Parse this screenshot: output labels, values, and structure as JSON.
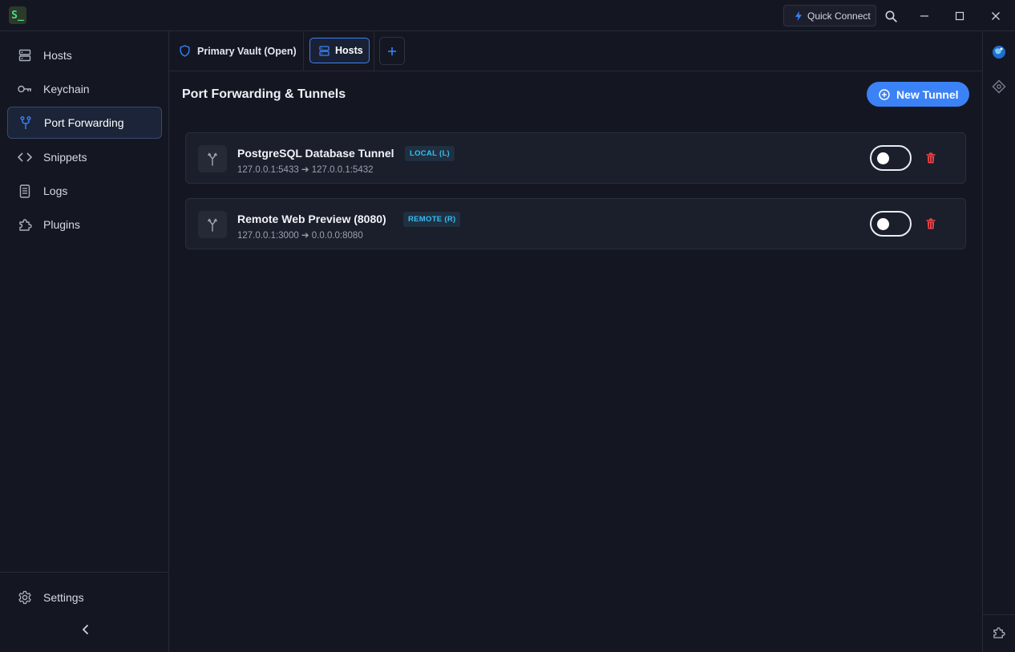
{
  "app": {
    "logo_text": "S_"
  },
  "titlebar": {
    "quick_connect_label": "Quick Connect"
  },
  "sidebar": {
    "items": [
      {
        "label": "Hosts",
        "icon": "server-icon"
      },
      {
        "label": "Keychain",
        "icon": "key-icon"
      },
      {
        "label": "Port Forwarding",
        "icon": "fork-icon",
        "active": true
      },
      {
        "label": "Snippets",
        "icon": "code-icon"
      },
      {
        "label": "Logs",
        "icon": "logs-icon"
      },
      {
        "label": "Plugins",
        "icon": "puzzle-icon"
      }
    ],
    "settings_label": "Settings"
  },
  "tabs": {
    "vault_label": "Primary Vault (Open)",
    "hosts_label": "Hosts",
    "add_label": "+"
  },
  "main": {
    "title": "Port Forwarding & Tunnels",
    "new_tunnel_label": "New Tunnel",
    "tunnels": [
      {
        "name": "PostgreSQL Database Tunnel",
        "badge": "LOCAL (L)",
        "route": "127.0.0.1:5433 ➔ 127.0.0.1:5432",
        "enabled": false
      },
      {
        "name": "Remote Web Preview (8080)",
        "badge": "REMOTE (R)",
        "route": "127.0.0.1:3000 ➔ 0.0.0.0:8080",
        "enabled": false
      }
    ]
  },
  "colors": {
    "accent": "#3b82f6",
    "background": "#141722",
    "card": "#1b1e2b",
    "badge_text": "#38bdf8",
    "danger": "#ef4444",
    "logo_green": "#4ade80"
  }
}
